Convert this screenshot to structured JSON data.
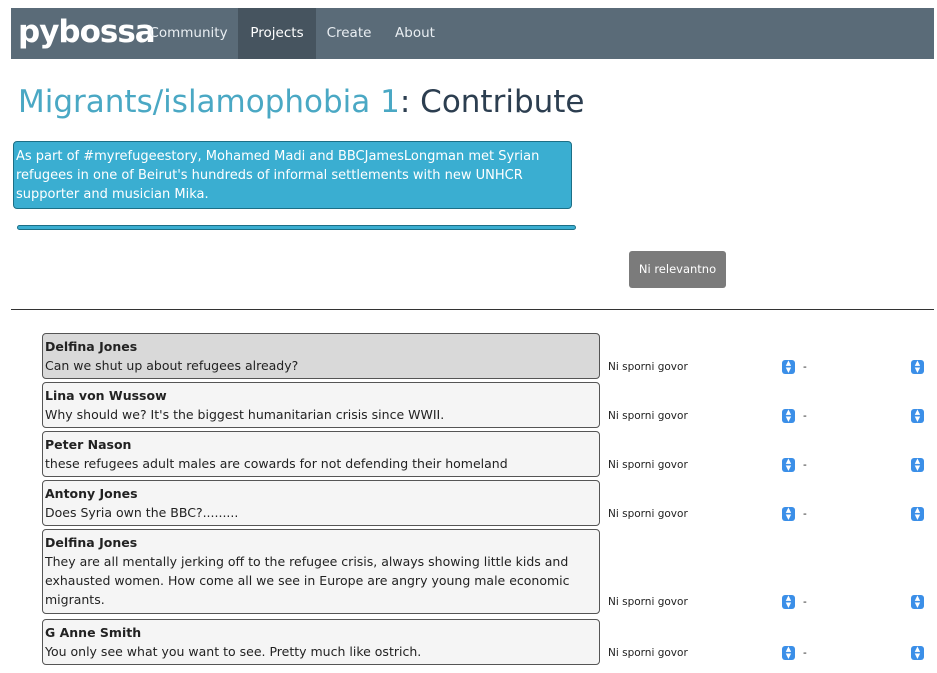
{
  "navbar": {
    "brand": "pybossa",
    "items": [
      "Community",
      "Projects",
      "Create",
      "About"
    ]
  },
  "page": {
    "title_link": "Migrants/islamophobia 1",
    "title_rest": ": Contribute"
  },
  "tweet": {
    "text": "As part of #myrefugeestory, Mohamed Madi and BBCJamesLongman met Syrian refugees in one of Beirut's hundreds of informal settlements with new UNHCR supporter and musician Mika."
  },
  "irrelevant_button": {
    "label": "Ni relevantno"
  },
  "comments": [
    {
      "author": "Delfina Jones",
      "text": "Can we shut up about refugees already?",
      "select_1": "Ni sporni govor",
      "select_2": "-"
    },
    {
      "author": "Lina von Wussow",
      "text": "Why should we? It's the biggest humanitarian crisis since WWII.",
      "select_1": "Ni sporni govor",
      "select_2": "-"
    },
    {
      "author": "Peter Nason",
      "text": "these refugees adult males are cowards for not defending their homeland",
      "select_1": "Ni sporni govor",
      "select_2": "-"
    },
    {
      "author": "Antony Jones",
      "text": "Does Syria own the BBC?.........",
      "select_1": "Ni sporni govor",
      "select_2": "-"
    },
    {
      "author": "Delfina Jones",
      "text": "They are all mentally jerking off to the refugee crisis, always showing little kids and exhausted women. How come all we see in Europe are angry young male economic migrants.",
      "select_1": "Ni sporni govor",
      "select_2": "-"
    },
    {
      "author": "G Anne Smith",
      "text": "You only see what you want to see. Pretty much like ostrich.",
      "select_1": "Ni sporni govor",
      "select_2": "-"
    }
  ],
  "colors": {
    "navbar": "#5a6b78",
    "accent": "#3aaed1",
    "title_link": "#4aa8c4"
  }
}
